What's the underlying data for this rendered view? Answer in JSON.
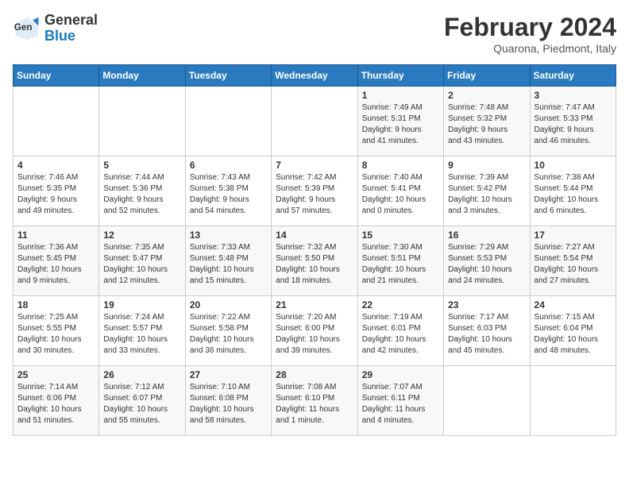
{
  "header": {
    "logo_general": "General",
    "logo_blue": "Blue",
    "month_title": "February 2024",
    "subtitle": "Quarona, Piedmont, Italy"
  },
  "weekdays": [
    "Sunday",
    "Monday",
    "Tuesday",
    "Wednesday",
    "Thursday",
    "Friday",
    "Saturday"
  ],
  "weeks": [
    [
      {
        "day": "",
        "info": ""
      },
      {
        "day": "",
        "info": ""
      },
      {
        "day": "",
        "info": ""
      },
      {
        "day": "",
        "info": ""
      },
      {
        "day": "1",
        "info": "Sunrise: 7:49 AM\nSunset: 5:31 PM\nDaylight: 9 hours\nand 41 minutes."
      },
      {
        "day": "2",
        "info": "Sunrise: 7:48 AM\nSunset: 5:32 PM\nDaylight: 9 hours\nand 43 minutes."
      },
      {
        "day": "3",
        "info": "Sunrise: 7:47 AM\nSunset: 5:33 PM\nDaylight: 9 hours\nand 46 minutes."
      }
    ],
    [
      {
        "day": "4",
        "info": "Sunrise: 7:46 AM\nSunset: 5:35 PM\nDaylight: 9 hours\nand 49 minutes."
      },
      {
        "day": "5",
        "info": "Sunrise: 7:44 AM\nSunset: 5:36 PM\nDaylight: 9 hours\nand 52 minutes."
      },
      {
        "day": "6",
        "info": "Sunrise: 7:43 AM\nSunset: 5:38 PM\nDaylight: 9 hours\nand 54 minutes."
      },
      {
        "day": "7",
        "info": "Sunrise: 7:42 AM\nSunset: 5:39 PM\nDaylight: 9 hours\nand 57 minutes."
      },
      {
        "day": "8",
        "info": "Sunrise: 7:40 AM\nSunset: 5:41 PM\nDaylight: 10 hours\nand 0 minutes."
      },
      {
        "day": "9",
        "info": "Sunrise: 7:39 AM\nSunset: 5:42 PM\nDaylight: 10 hours\nand 3 minutes."
      },
      {
        "day": "10",
        "info": "Sunrise: 7:38 AM\nSunset: 5:44 PM\nDaylight: 10 hours\nand 6 minutes."
      }
    ],
    [
      {
        "day": "11",
        "info": "Sunrise: 7:36 AM\nSunset: 5:45 PM\nDaylight: 10 hours\nand 9 minutes."
      },
      {
        "day": "12",
        "info": "Sunrise: 7:35 AM\nSunset: 5:47 PM\nDaylight: 10 hours\nand 12 minutes."
      },
      {
        "day": "13",
        "info": "Sunrise: 7:33 AM\nSunset: 5:48 PM\nDaylight: 10 hours\nand 15 minutes."
      },
      {
        "day": "14",
        "info": "Sunrise: 7:32 AM\nSunset: 5:50 PM\nDaylight: 10 hours\nand 18 minutes."
      },
      {
        "day": "15",
        "info": "Sunrise: 7:30 AM\nSunset: 5:51 PM\nDaylight: 10 hours\nand 21 minutes."
      },
      {
        "day": "16",
        "info": "Sunrise: 7:29 AM\nSunset: 5:53 PM\nDaylight: 10 hours\nand 24 minutes."
      },
      {
        "day": "17",
        "info": "Sunrise: 7:27 AM\nSunset: 5:54 PM\nDaylight: 10 hours\nand 27 minutes."
      }
    ],
    [
      {
        "day": "18",
        "info": "Sunrise: 7:25 AM\nSunset: 5:55 PM\nDaylight: 10 hours\nand 30 minutes."
      },
      {
        "day": "19",
        "info": "Sunrise: 7:24 AM\nSunset: 5:57 PM\nDaylight: 10 hours\nand 33 minutes."
      },
      {
        "day": "20",
        "info": "Sunrise: 7:22 AM\nSunset: 5:58 PM\nDaylight: 10 hours\nand 36 minutes."
      },
      {
        "day": "21",
        "info": "Sunrise: 7:20 AM\nSunset: 6:00 PM\nDaylight: 10 hours\nand 39 minutes."
      },
      {
        "day": "22",
        "info": "Sunrise: 7:19 AM\nSunset: 6:01 PM\nDaylight: 10 hours\nand 42 minutes."
      },
      {
        "day": "23",
        "info": "Sunrise: 7:17 AM\nSunset: 6:03 PM\nDaylight: 10 hours\nand 45 minutes."
      },
      {
        "day": "24",
        "info": "Sunrise: 7:15 AM\nSunset: 6:04 PM\nDaylight: 10 hours\nand 48 minutes."
      }
    ],
    [
      {
        "day": "25",
        "info": "Sunrise: 7:14 AM\nSunset: 6:06 PM\nDaylight: 10 hours\nand 51 minutes."
      },
      {
        "day": "26",
        "info": "Sunrise: 7:12 AM\nSunset: 6:07 PM\nDaylight: 10 hours\nand 55 minutes."
      },
      {
        "day": "27",
        "info": "Sunrise: 7:10 AM\nSunset: 6:08 PM\nDaylight: 10 hours\nand 58 minutes."
      },
      {
        "day": "28",
        "info": "Sunrise: 7:08 AM\nSunset: 6:10 PM\nDaylight: 11 hours\nand 1 minute."
      },
      {
        "day": "29",
        "info": "Sunrise: 7:07 AM\nSunset: 6:11 PM\nDaylight: 11 hours\nand 4 minutes."
      },
      {
        "day": "",
        "info": ""
      },
      {
        "day": "",
        "info": ""
      }
    ]
  ]
}
